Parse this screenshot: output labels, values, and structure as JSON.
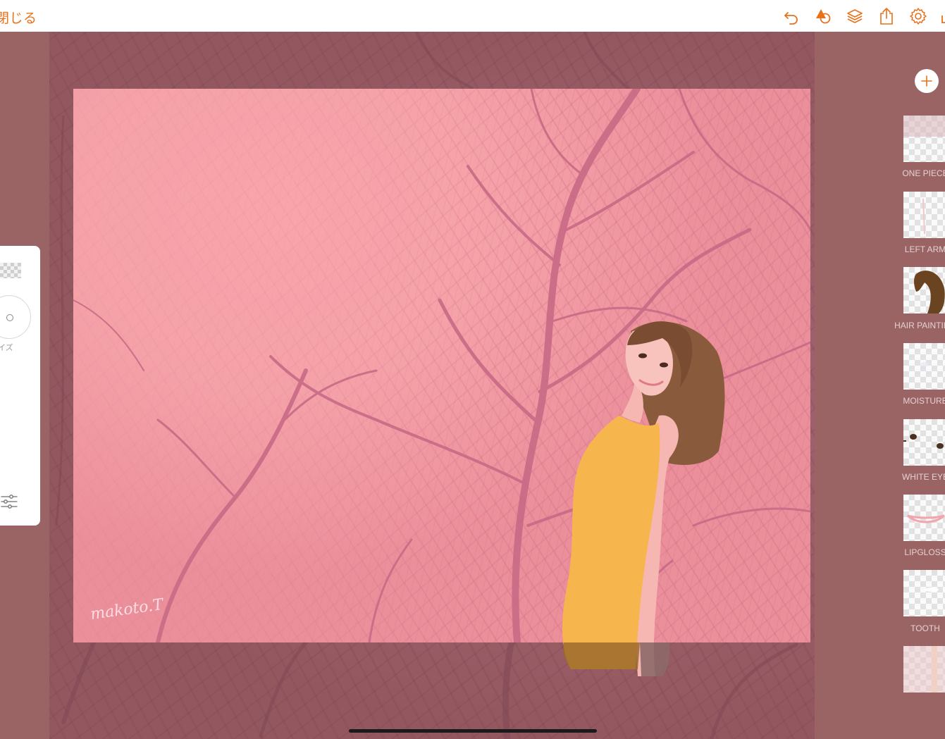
{
  "topbar": {
    "close_label": "閉じる",
    "icons": [
      "undo-icon",
      "shapes-icon",
      "layers-icon",
      "share-icon",
      "settings-icon"
    ],
    "accent": "#e8711a"
  },
  "canvas": {
    "signature": "makoto.T",
    "background": "#f5a1a8"
  },
  "left_panel": {
    "size_label": "サイズ"
  },
  "layers": {
    "items": [
      {
        "name": "ONE PIECE"
      },
      {
        "name": "LEFT ARM"
      },
      {
        "name": "HAIR PAINTING"
      },
      {
        "name": "MOISTURE"
      },
      {
        "name": "WHITE EYE"
      },
      {
        "name": "LIPGLOSS"
      },
      {
        "name": "TOOTH"
      },
      {
        "name": ""
      }
    ]
  },
  "colors": {
    "workspace": "#9a6465",
    "panel": "#ffffff",
    "dress": "#f7b54e",
    "hair": "#8a5a3c",
    "skin": "#f6b7b2"
  }
}
